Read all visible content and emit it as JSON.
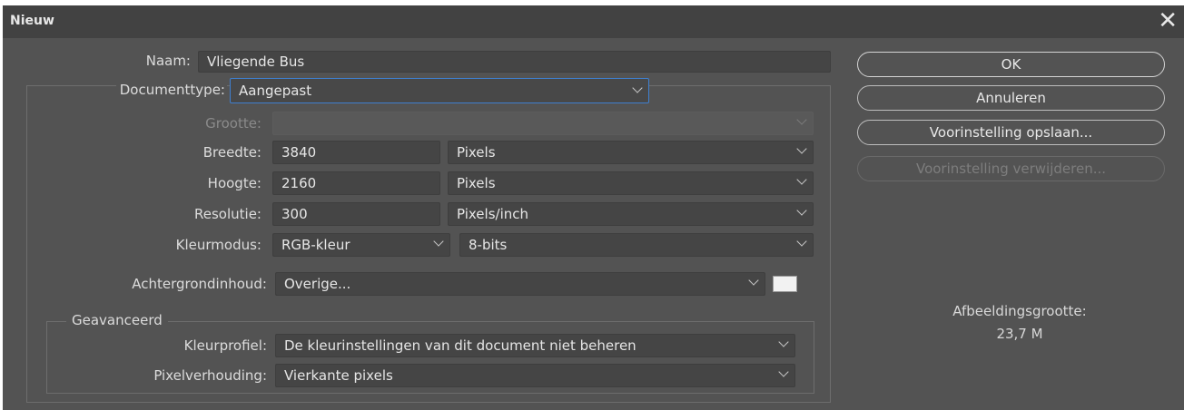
{
  "dialog": {
    "title": "Nieuw",
    "close_glyph": "✕"
  },
  "form": {
    "name_label": "Naam:",
    "name_value": "Vliegende Bus",
    "doctype_label": "Documenttype:",
    "doctype_value": "Aangepast",
    "size_label": "Grootte:",
    "size_value": "",
    "width_label": "Breedte:",
    "width_value": "3840",
    "width_unit": "Pixels",
    "height_label": "Hoogte:",
    "height_value": "2160",
    "height_unit": "Pixels",
    "resolution_label": "Resolutie:",
    "resolution_value": "300",
    "resolution_unit": "Pixels/inch",
    "colormode_label": "Kleurmodus:",
    "colormode_value": "RGB-kleur",
    "bitdepth_value": "8-bits",
    "background_label": "Achtergrondinhoud:",
    "background_value": "Overige...",
    "background_color": "#f2f2f2"
  },
  "advanced": {
    "title": "Geavanceerd",
    "profile_label": "Kleurprofiel:",
    "profile_value": "De kleurinstellingen van dit document niet beheren",
    "pixel_aspect_label": "Pixelverhouding:",
    "pixel_aspect_value": "Vierkante pixels"
  },
  "buttons": {
    "ok": "OK",
    "cancel": "Annuleren",
    "save_preset": "Voorinstelling opslaan...",
    "delete_preset": "Voorinstelling verwijderen..."
  },
  "image_size": {
    "label": "Afbeeldingsgrootte:",
    "value": "23,7 M"
  },
  "icons": {
    "dropdown": "chevron-down-icon",
    "close": "close-icon"
  }
}
